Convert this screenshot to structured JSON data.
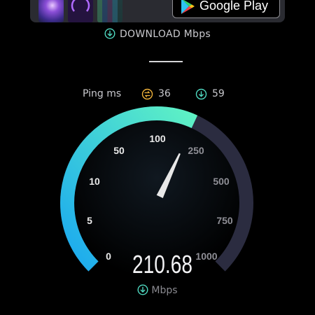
{
  "banner": {
    "store_button_label": "Google Play",
    "thumbnails": [
      "app-screenshot-1",
      "app-screenshot-2",
      "app-screenshot-3"
    ]
  },
  "test": {
    "download_label": "DOWNLOAD Mbps",
    "ping_label": "Ping ms",
    "ping_idle": "36",
    "ping_download": "59"
  },
  "gauge": {
    "tick_labels": [
      "0",
      "5",
      "10",
      "50",
      "100",
      "250",
      "500",
      "750",
      "1000"
    ],
    "current_speed": "210.68",
    "current_speed_value": 210.68,
    "unit_label": "Mbps",
    "colors": {
      "active_start": "#1aa8f0",
      "active_end": "#5ff2c4",
      "track": "#2b2c40",
      "needle": "#e8e8e8"
    }
  },
  "icons": [
    "download-circle-icon",
    "ping-idle-icon",
    "ping-download-icon",
    "google-play-icon"
  ]
}
